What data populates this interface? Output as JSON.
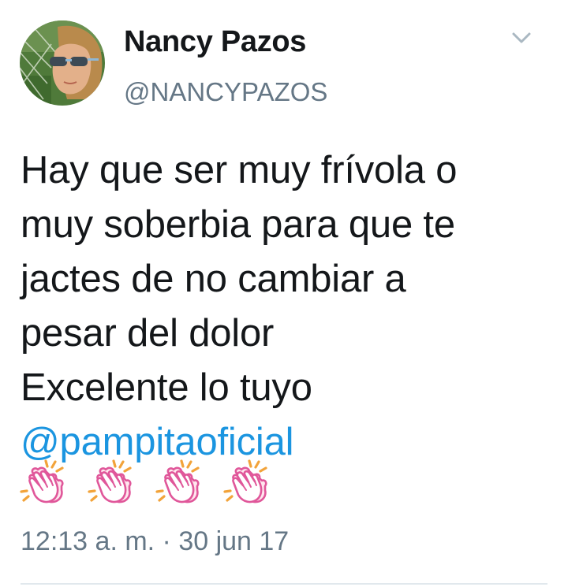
{
  "user": {
    "display_name": "Nancy Pazos",
    "handle": "@NANCYPAZOS"
  },
  "tweet": {
    "lines": [
      "Hay que ser muy frívola o",
      "muy soberbia para que te",
      "jactes de no cambiar a",
      "pesar del dolor",
      "Excelente lo tuyo"
    ],
    "mention": "@pampitaoficial",
    "emoji_count": 4,
    "emoji_name": "clapping-hands",
    "timestamp": "12:13 a. m. · 30 jun 17"
  },
  "colors": {
    "text": "#14171a",
    "secondary": "#657786",
    "link": "#1b95e0",
    "divider": "#e1e8ed"
  },
  "icons": {
    "menu": "chevron-down-icon",
    "emoji": "clapping-hands-icon"
  }
}
